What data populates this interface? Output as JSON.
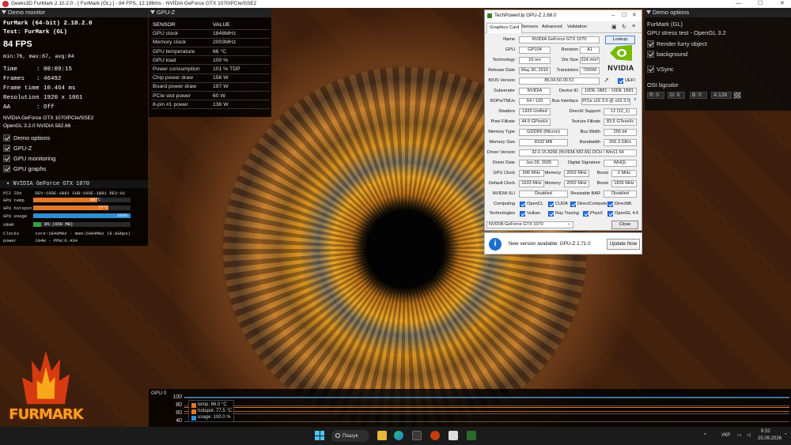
{
  "window_title": "Geeks3D FurMark 2.10.2.0 - [ FurMark (GL) ] - 84 FPS, 12.196ms - NVIDIA GeForce GTX 1070/PCIe/SSE2",
  "demo_monitor": {
    "header": "Demo monitor",
    "line1": "FurMark (64-bit) 2.10.2.0",
    "line2": "Test: FurMark (GL)",
    "fps": "84 FPS",
    "minmax": "min:76, max:87, avg:84",
    "stats": [
      {
        "k": "Time",
        "v": "00:09:15"
      },
      {
        "k": "Frames",
        "v": "46492"
      },
      {
        "k": "Frame time",
        "v": "10.464 ms"
      },
      {
        "k": "Resolution",
        "v": "1920 x 1061"
      },
      {
        "k": "AA",
        "v": "Off"
      }
    ],
    "gpu_name": "NVIDIA GeForce GTX 1070/PCIe/SSE2",
    "opengl": "OpenGL 3.2.0 NVIDIA 582.66",
    "toggles": [
      "Demo options",
      "GPU-Z",
      "GPU monitoring",
      "GPU graphs"
    ]
  },
  "gpu_panel": {
    "header": "NVIDIA GeForce GTX 1070",
    "pci": "PCI IDs     DEV:10DE-1B81 SUB:10DE-1B81 REV:A1",
    "temp_label": "GPU temp",
    "temp_value": "66°C",
    "temp_fraction": 0.66,
    "hotspot_label": "GPU hotspot",
    "hotspot_value": "77°C",
    "hotspot_fraction": 0.77,
    "usage_label": "GPU usage",
    "usage_value": "100%",
    "usage_fraction": 1.0,
    "vram_label": "VRAM",
    "vram_value": "8% (650 MB)",
    "vram_fraction": 0.08,
    "clocks": "Clocks      core:1848MHz - mem:2004MHz (8.0Gbps)",
    "power": "power       194W - PPW:0.434",
    "colors": {
      "temp": "#e0782a",
      "usage": "#2f8fd0",
      "vram": "#3aa03a"
    }
  },
  "gpuz_overlay": {
    "header": "GPU-Z",
    "col_sensor": "SENSOR",
    "col_value": "VALUE",
    "rows": [
      {
        "k": "GPU clock",
        "v": "1848MHz"
      },
      {
        "k": "Memory clock",
        "v": "2003MHz"
      },
      {
        "k": "GPU temperature",
        "v": "66 °C"
      },
      {
        "k": "GPU load",
        "v": "100 %"
      },
      {
        "k": "Power consumption",
        "v": "101 % TDP"
      },
      {
        "k": "Chip power draw",
        "v": "156 W"
      },
      {
        "k": "Board power draw",
        "v": "197 W"
      },
      {
        "k": "PCIe slot power",
        "v": "60 W"
      },
      {
        "k": "8-pin #1 power",
        "v": "136 W"
      }
    ]
  },
  "demo_options": {
    "header": "Demo options",
    "name": "FurMark (GL)",
    "desc": "GPU stress test - OpenGL 3.2",
    "render_furry": "Render furry object",
    "background": "background",
    "vsync": "VSync",
    "osi": "OSI bgcolor",
    "r": "R: 0",
    "g": "G: 0",
    "b": "B: 0",
    "a": "A:128"
  },
  "gpuz_window": {
    "title": "TechPowerUp GPU-Z 2.68.0",
    "tabs": [
      "Graphics Card",
      "Sensors",
      "Advanced",
      "Validation"
    ],
    "lookup": "Lookup",
    "name_label": "Name",
    "name": "NVIDIA GeForce GTX 1070",
    "gpu_label": "GPU",
    "gpu": "GP104",
    "revision_label": "Revision",
    "revision": "A1",
    "tech_label": "Technology",
    "tech": "16 nm",
    "die_label": "Die Size",
    "die": "314 mm²",
    "release_label": "Release Date",
    "release": "May 30, 2016",
    "trans_label": "Transistors",
    "trans": "7200M",
    "bios_label": "BIOS Version",
    "bios": "86.04.50.00.51",
    "uefi": "UEFI",
    "subvendor_label": "Subvendor",
    "subvendor": "NVIDIA",
    "devid_label": "Device ID",
    "devid": "10DE 1B81 - 10DE 1B81",
    "rops_label": "ROPs/TMUs",
    "rops": "64 / 120",
    "bus_label": "Bus Interface",
    "bus": "PCIe x16 3.0 @ x16 3.0",
    "shaders_label": "Shaders",
    "shaders": "1920 Unified",
    "dx_label": "DirectX Support",
    "dx": "12 (12_1)",
    "pfill_label": "Pixel Fillrate",
    "pfill": "44.5 GPixel/s",
    "tfill_label": "Texture Fillrate",
    "tfill": "83.5 GTexel/s",
    "memtype_label": "Memory Type",
    "memtype": "GDDR5 (Micron)",
    "buswidth_label": "Bus Width",
    "buswidth": "256 bit",
    "memsize_label": "Memory Size",
    "memsize": "8192 MB",
    "bw_label": "Bandwidth",
    "bw": "256.3 GB/s",
    "driver_label": "Driver Version",
    "driver": "32.0.15.8266 (NVIDIA 582.66) DCH / Win11 64",
    "ddate_label": "Driver Date",
    "ddate": "Jun 09, 2026",
    "dsig_label": "Digital Signature",
    "dsig": "WHQL",
    "gclock_label": "GPU Clock",
    "gclock": "696 MHz",
    "mem_label": "Memory",
    "mem": "2002 MHz",
    "boost_label": "Boost",
    "boost": "0 MHz",
    "dclock_label": "Default Clock",
    "dclock": "1633 MHz",
    "dmem": "2002 MHz",
    "dboost": "1835 MHz",
    "sli_label": "NVIDIA SLI",
    "sli": "Disabled",
    "rbar_label": "Resizable BAR",
    "rbar": "Disabled",
    "computing_label": "Computing",
    "computing": [
      "OpenCL",
      "CUDA",
      "DirectCompute",
      "DirectML"
    ],
    "tech2_label": "Technologies",
    "technologies": [
      "Vulkan",
      "Ray Tracing",
      "PhysX",
      "OpenGL 4.6"
    ],
    "select": "NVIDIA GeForce GTX 1070",
    "close": "Close",
    "nvidia": "NVIDIA"
  },
  "notification": {
    "text": "New version available: GPU-Z 2.71.0",
    "button": "Update Now"
  },
  "graph": {
    "title": "GPU 0",
    "yticks": [
      "100",
      "80",
      "60",
      "40"
    ],
    "legend": [
      {
        "label": "temp: 66.0 °C",
        "color": "#e0782a"
      },
      {
        "label": "hotspot: 77.5 °C",
        "color": "#e0782a"
      },
      {
        "label": "usage: 100.0 %",
        "color": "#2f8fd0"
      }
    ]
  },
  "logo_text": "FURMARK",
  "taskbar": {
    "search": "Пошук",
    "lang": "УКР",
    "time": "9:32",
    "date": "25.09.2026"
  }
}
